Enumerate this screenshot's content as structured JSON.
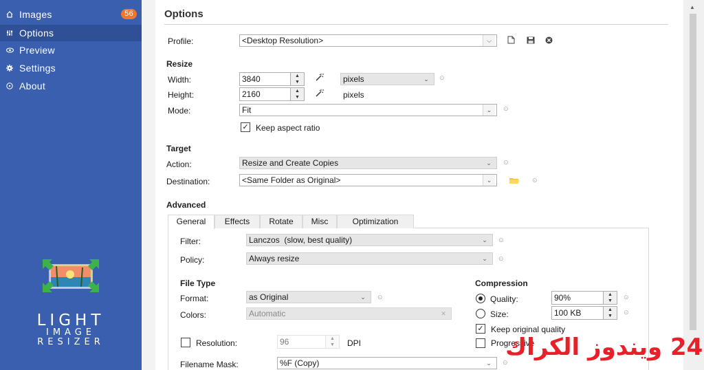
{
  "sidebar": {
    "items": [
      {
        "label": "Images",
        "icon": "images-icon",
        "badge": "56"
      },
      {
        "label": "Options",
        "icon": "options-icon"
      },
      {
        "label": "Preview",
        "icon": "eye-icon"
      },
      {
        "label": "Settings",
        "icon": "gear-icon"
      },
      {
        "label": "About",
        "icon": "info-icon"
      }
    ],
    "active": "Options",
    "logo": {
      "line1": "LIGHT",
      "line2": "IMAGE",
      "line3": "RESIZER"
    }
  },
  "main": {
    "title": "Options",
    "profile": {
      "label": "Profile:",
      "value": "<Desktop Resolution>"
    },
    "resize": {
      "heading": "Resize",
      "width_label": "Width:",
      "width_value": "3840",
      "height_label": "Height:",
      "height_value": "2160",
      "unit_selected": "pixels",
      "unit_text": "pixels",
      "mode_label": "Mode:",
      "mode_value": "Fit",
      "keep_aspect_label": "Keep aspect ratio",
      "keep_aspect_checked": true
    },
    "target": {
      "heading": "Target",
      "action_label": "Action:",
      "action_value": "Resize and Create Copies",
      "destination_label": "Destination:",
      "destination_value": "<Same Folder as Original>"
    },
    "advanced": {
      "heading": "Advanced",
      "tabs": [
        "General",
        "Effects",
        "Rotate",
        "Misc",
        "Optimization"
      ],
      "active_tab": "General",
      "filter_label": "Filter:",
      "filter_value": "Lanczos  (slow, best quality)",
      "policy_label": "Policy:",
      "policy_value": "Always resize",
      "file_type": {
        "heading": "File Type",
        "format_label": "Format:",
        "format_value": "as Original",
        "colors_label": "Colors:",
        "colors_value": "Automatic"
      },
      "compression": {
        "heading": "Compression",
        "quality_label": "Quality:",
        "quality_value": "90%",
        "quality_selected": true,
        "size_label": "Size:",
        "size_value": "100 KB",
        "keep_quality_label": "Keep original quality",
        "keep_quality_checked": true,
        "progressive_label": "Progressive",
        "progressive_checked": false
      },
      "resolution_label": "Resolution:",
      "resolution_value": "96",
      "resolution_unit": "DPI",
      "resolution_checked": false,
      "filename_mask_label": "Filename Mask:",
      "filename_mask_value": "%F (Copy)"
    }
  },
  "watermark_text": "24 ويندوز الكراك",
  "colors": {
    "sidebar": "#3a5fae",
    "sidebar_active": "#2f4f96",
    "badge": "#f4762a",
    "watermark": "#e8202a"
  }
}
